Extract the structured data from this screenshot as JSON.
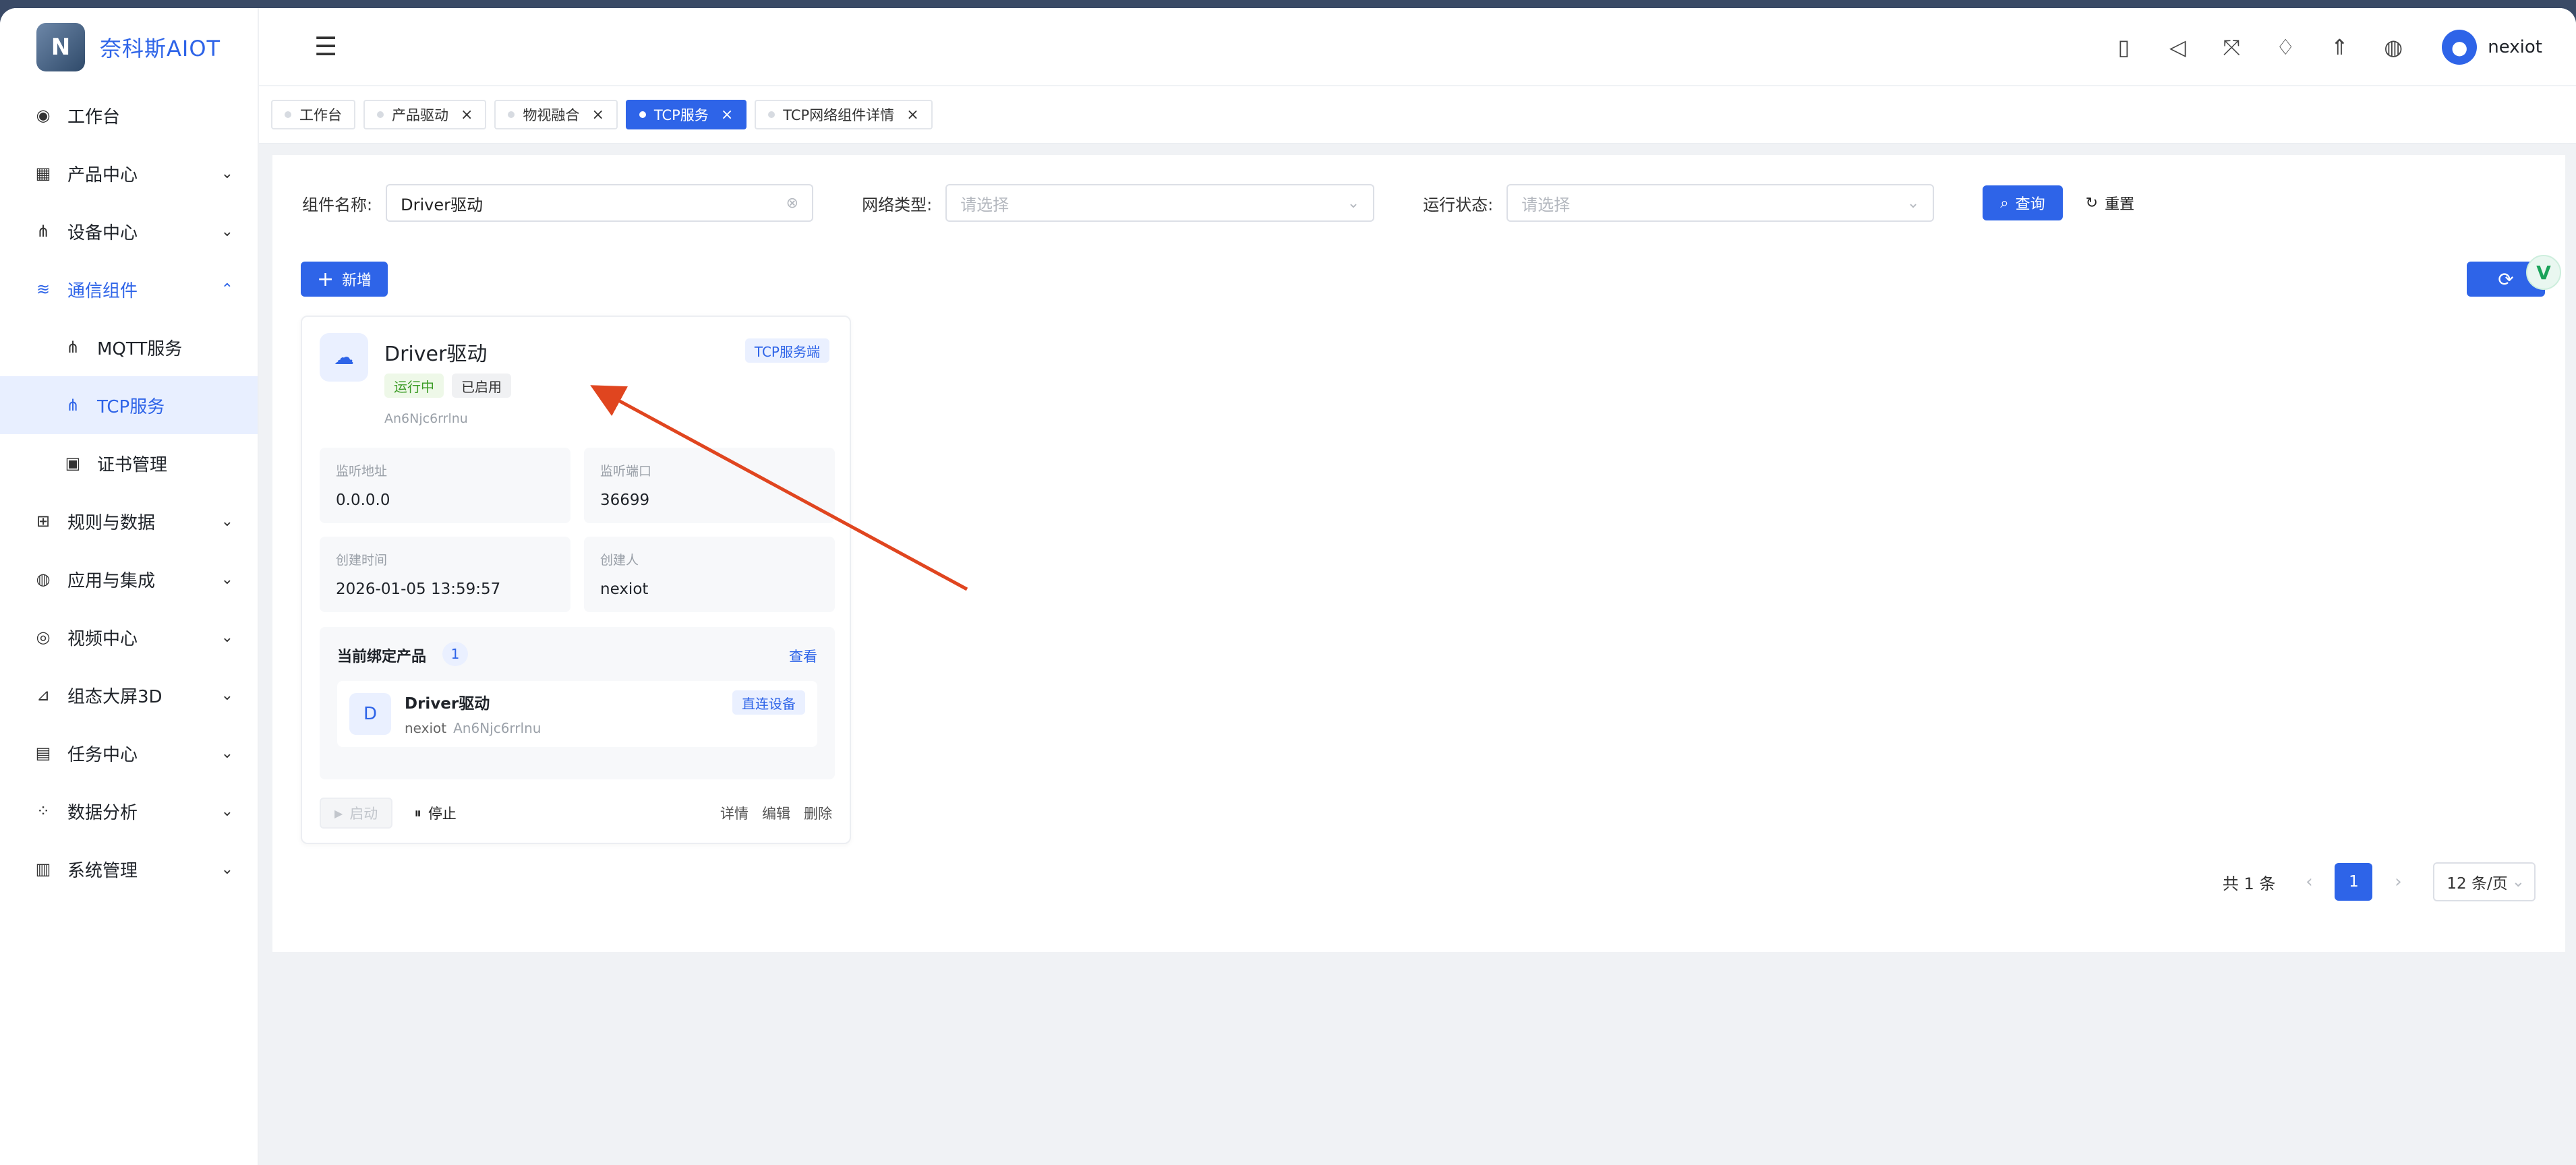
{
  "app": {
    "brand_name": "奈科斯AIOT",
    "brand_logo_char": "N"
  },
  "sidebar": {
    "items": [
      {
        "label": "工作台",
        "icon": "dashboard-icon",
        "glyph": "◉"
      },
      {
        "label": "产品中心",
        "icon": "product-icon",
        "glyph": "▦",
        "arrow": "⌄"
      },
      {
        "label": "设备中心",
        "icon": "device-icon",
        "glyph": "⋔",
        "arrow": "⌄"
      },
      {
        "label": "通信组件",
        "icon": "wifi-icon",
        "glyph": "≋",
        "arrow": "⌃"
      },
      {
        "label": "MQTT服务",
        "icon": "mqtt-icon",
        "glyph": "⋔"
      },
      {
        "label": "TCP服务",
        "icon": "tcp-icon",
        "glyph": "⋔"
      },
      {
        "label": "证书管理",
        "icon": "certificate-icon",
        "glyph": "▣"
      },
      {
        "label": "规则与数据",
        "icon": "rule-icon",
        "glyph": "⊞",
        "arrow": "⌄"
      },
      {
        "label": "应用与集成",
        "icon": "app-icon",
        "glyph": "◍",
        "arrow": "⌄"
      },
      {
        "label": "视频中心",
        "icon": "eye-icon",
        "glyph": "◎",
        "arrow": "⌄"
      },
      {
        "label": "组态大屏3D",
        "icon": "chart-icon",
        "glyph": "⊿",
        "arrow": "⌄"
      },
      {
        "label": "任务中心",
        "icon": "task-icon",
        "glyph": "▤",
        "arrow": "⌄"
      },
      {
        "label": "数据分析",
        "icon": "analysis-icon",
        "glyph": "⁘",
        "arrow": "⌄"
      },
      {
        "label": "系统管理",
        "icon": "system-icon",
        "glyph": "▥",
        "arrow": "⌄"
      }
    ]
  },
  "header": {
    "collapse_glyph": "☰",
    "icons": [
      {
        "name": "book-icon",
        "glyph": "▯"
      },
      {
        "name": "megaphone-icon",
        "glyph": "◁"
      },
      {
        "name": "fullscreen-icon",
        "glyph": "⤧"
      },
      {
        "name": "bell-icon",
        "glyph": "♢"
      },
      {
        "name": "rocket-icon",
        "glyph": "⇑"
      },
      {
        "name": "globe-icon",
        "glyph": "◍"
      }
    ],
    "avatar_glyph": "●",
    "username": "nexiot"
  },
  "tabs": [
    {
      "label": "工作台",
      "closable": false,
      "active": false
    },
    {
      "label": "产品驱动",
      "closable": true,
      "active": false
    },
    {
      "label": "物视融合",
      "closable": true,
      "active": false
    },
    {
      "label": "TCP服务",
      "closable": true,
      "active": true
    },
    {
      "label": "TCP网络组件详情",
      "closable": true,
      "active": false
    }
  ],
  "close_glyph": "×",
  "filters": {
    "name_label": "组件名称:",
    "name_value": "Driver驱动",
    "clear_glyph": "⊗",
    "network_label": "网络类型:",
    "network_placeholder": "请选择",
    "status_label": "运行状态:",
    "status_placeholder": "请选择",
    "chevron": "⌄",
    "search_label": "查询",
    "search_glyph": "⌕",
    "reset_label": "重置",
    "reset_glyph": "↻"
  },
  "toolbar": {
    "add_label": "新增",
    "add_glyph": "+",
    "refresh_glyph": "⟳",
    "badge_char": "V"
  },
  "card": {
    "icon_glyph": "☁",
    "title": "Driver驱动",
    "protocol_tag": "TCP服务端",
    "status_running": "运行中",
    "status_enabled": "已启用",
    "code": "An6Njc6rrlnu",
    "listen_addr_label": "监听地址",
    "listen_addr": "0.0.0.0",
    "listen_port_label": "监听端口",
    "listen_port": "36699",
    "created_time_label": "创建时间",
    "created_time": "2026-01-05 13:59:57",
    "creator_label": "创建人",
    "creator": "nexiot",
    "bound_title": "当前绑定产品",
    "bound_count": "1",
    "bound_view": "查看",
    "bound_item": {
      "avatar": "D",
      "name": "Driver驱动",
      "owner": "nexiot",
      "code": "An6Njc6rrlnu",
      "type": "直连设备"
    },
    "start_label": "启动",
    "start_glyph": "▶",
    "stop_label": "停止",
    "stop_glyph": "⏸",
    "detail_label": "详情",
    "edit_label": "编辑",
    "delete_label": "删除"
  },
  "pagination": {
    "total": "共 1 条",
    "prev": "‹",
    "page": "1",
    "next": "›",
    "size": "12 条/页",
    "size_chevron": "⌄"
  },
  "colors": {
    "accent": "#2e64e8",
    "annotation_arrow": "#e0451f",
    "running": "#3c9c26"
  }
}
